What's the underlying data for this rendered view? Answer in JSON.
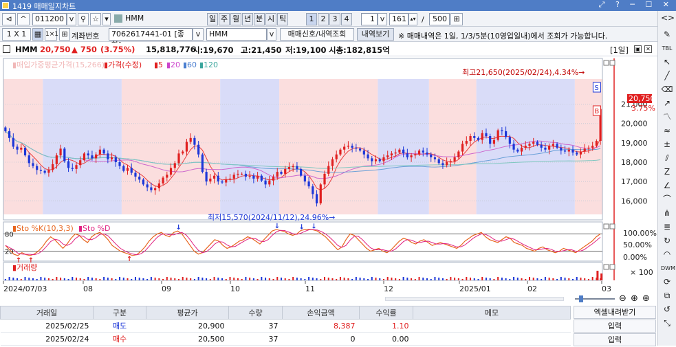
{
  "window": {
    "title": "1419 매매일지차트",
    "controls": "⤢ ? ─ ☐ ✕"
  },
  "toolbar1": {
    "nav_prev": "⊲▷",
    "code": "011200",
    "stock_name": "HMM",
    "periods": [
      "일",
      "주",
      "월",
      "년",
      "분",
      "시",
      "틱"
    ],
    "numbers": [
      "1",
      "2",
      "3",
      "4"
    ],
    "interval": "1",
    "count": "161",
    "slash": "/",
    "max": "500"
  },
  "toolbar2": {
    "mult": "1 X 1",
    "mult2": "1×1",
    "account_label": "계좌번호",
    "account_value": "7062617441-01 [종합]",
    "stock_select": "HMM",
    "btn_signal": "매매신호/내역조회",
    "btn_history": "내역보기",
    "note": "※ 매매내역은 1일, 1/3/5분(10영업일내)에서 조회가 가능합니다."
  },
  "info": {
    "name": "HMM",
    "price": "20,750",
    "change": "▲ 750",
    "change_pct": "(3.75%)",
    "volume": "15,818,776",
    "open": "시:19,670",
    "high": "고:21,450",
    "low": "저:19,100",
    "mktcap": "시총:182,815억",
    "period_badge": "[1일]"
  },
  "price_legend": {
    "l1": "▮매입가중평균가격(15,266)",
    "l2": "▮가격(수정)",
    "l3": "▮5",
    "l4": "▮20",
    "l5": "▮60",
    "l6": "▮120"
  },
  "sto_legend": {
    "l1": "▮Sto %K(10,3,3)",
    "l2": "▮Sto %D"
  },
  "vol_legend": {
    "l1": "▮거래량"
  },
  "annotations": {
    "high": "최고21,650(2025/02/24),4.34%→",
    "low": "최저15,570(2024/11/12),24.96%→",
    "s_marker": "S",
    "b_marker": "B",
    "cur_price": "20,750",
    "cur_pct": "3.75%"
  },
  "chart_data": {
    "type": "candlestick",
    "y_axis": {
      "ticks": [
        "21,000",
        "20,000",
        "19,000",
        "18,000",
        "17,000",
        "16,000"
      ],
      "values": [
        21000,
        20000,
        19000,
        18000,
        17000,
        16000
      ],
      "ylim": [
        15300,
        22300
      ]
    },
    "sto_axis": {
      "ticks": [
        "100.00%",
        "50.00%",
        "0.00%"
      ],
      "left_ticks": [
        "80",
        "20"
      ]
    },
    "vol_axis": {
      "ticks": [
        "× 100"
      ]
    },
    "x_labels": [
      "2024/07/03",
      "08",
      "09",
      "10",
      "11",
      "12",
      "2025/01",
      "02",
      "03"
    ],
    "closes": [
      19600,
      19250,
      18800,
      18650,
      18750,
      18350,
      17950,
      17800,
      17600,
      17550,
      17450,
      17600,
      17900,
      18350,
      18700,
      18050,
      17700,
      17650,
      17850,
      18100,
      18450,
      18350,
      18200,
      18400,
      18650,
      18450,
      18150,
      18250,
      18000,
      17800,
      17550,
      17700,
      17450,
      17250,
      17100,
      16850,
      16700,
      16550,
      16650,
      16900,
      17200,
      17350,
      17700,
      17950,
      18450,
      18550,
      19050,
      19250,
      18900,
      18400,
      17500,
      17000,
      17150,
      17300,
      17000,
      16950,
      17100,
      17150,
      17350,
      17400,
      17400,
      17250,
      17300,
      17150,
      17300,
      17050,
      16850,
      17050,
      17250,
      17500,
      17400,
      17650,
      17750,
      17800,
      17650,
      17300,
      17000,
      16750,
      16350,
      15870,
      16850,
      17400,
      17800,
      18150,
      18400,
      18650,
      18800,
      18850,
      18750,
      18700,
      18600,
      18400,
      18200,
      18050,
      18150,
      18050,
      18250,
      18350,
      18450,
      18500,
      18650,
      18450,
      18250,
      18350,
      18400,
      18600,
      18500,
      18400,
      18250,
      18150,
      17950,
      17850,
      18000,
      18050,
      18250,
      18550,
      18950,
      19100,
      19350,
      19250,
      19150,
      19500,
      19350,
      18950,
      19150,
      19650,
      19600,
      19300,
      18950,
      18650,
      18550,
      18750,
      18850,
      18950,
      19050,
      18900,
      18750,
      18650,
      18850,
      18950,
      18750,
      18600,
      18550,
      18650,
      18500,
      18400,
      18550,
      18700,
      18750,
      18850,
      19100,
      20750
    ],
    "sto_k": [
      40,
      25,
      10,
      5,
      15,
      8,
      5,
      10,
      20,
      35,
      55,
      70,
      60,
      45,
      30,
      45,
      65,
      80,
      75,
      60,
      50,
      70,
      80,
      85,
      75,
      60,
      40,
      30,
      20,
      15,
      10,
      5,
      8,
      20,
      35,
      55,
      70,
      80,
      85,
      75,
      70,
      85,
      90,
      80,
      60,
      40,
      20,
      10,
      15,
      30,
      45,
      60,
      55,
      40,
      30,
      35,
      45,
      55,
      60,
      70,
      65,
      55,
      45,
      60,
      75,
      90,
      95,
      92,
      88,
      80,
      75,
      80,
      92,
      95,
      96,
      94,
      90,
      80,
      70,
      55,
      40,
      25,
      35,
      60,
      80,
      75,
      60,
      45,
      30,
      20,
      25,
      30,
      20,
      15,
      25,
      40,
      55,
      65,
      60,
      50,
      45,
      55,
      60,
      50,
      40,
      45,
      50,
      45,
      40,
      35,
      30,
      40,
      55,
      65,
      75,
      80,
      85,
      70,
      60,
      55,
      50,
      60,
      70,
      65,
      50,
      45,
      40,
      30,
      25,
      20,
      30,
      35,
      25,
      20,
      15,
      20,
      30,
      25,
      20,
      15,
      25,
      35,
      45,
      55,
      70,
      80
    ]
  },
  "zoom": {
    "icons": [
      "⊖",
      "⊕",
      "⊕"
    ]
  },
  "table": {
    "headers": [
      "거래일",
      "구분",
      "평균가",
      "수량",
      "손익금액",
      "수익률",
      "메모"
    ],
    "rows": [
      {
        "date": "2025/02/25",
        "type": "매도",
        "price": "20,900",
        "qty": "37",
        "pnl": "8,387",
        "rate": "1.10",
        "memo": ""
      },
      {
        "date": "2025/02/24",
        "type": "매수",
        "price": "20,500",
        "qty": "37",
        "pnl": "0",
        "rate": "0.00",
        "memo": ""
      }
    ],
    "excel_label": "엑셀내려받기",
    "input_label": "입력"
  },
  "colors": {
    "title_bg": "#4f7dc6",
    "up": "#e02020",
    "down": "#1c37d8",
    "band_pink": "#fbdede",
    "band_blue": "#d9dcf8"
  }
}
